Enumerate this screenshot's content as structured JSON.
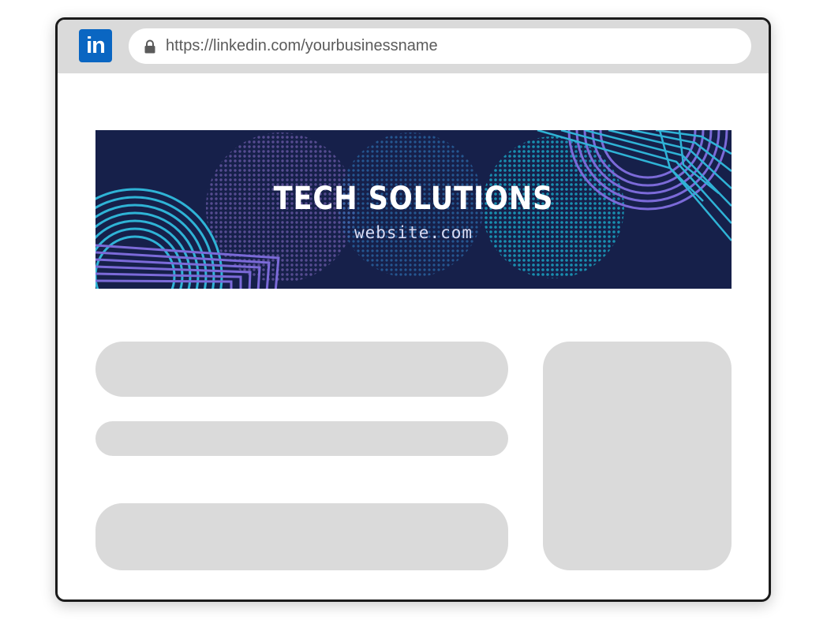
{
  "browser": {
    "logo_text": "in",
    "url": "https://linkedin.com/yourbusinessname",
    "icons": [
      "linkedin-logo",
      "lock-icon"
    ]
  },
  "banner": {
    "title": "TECH SOLUTIONS",
    "subtitle": "website.com",
    "colors": {
      "background": "#16204a",
      "accent_cyan": "#2fb3d6",
      "accent_purple": "#7b6ad8",
      "dot_cyan": "#1aa3c2",
      "dot_purple": "#6b5ba8"
    }
  },
  "placeholders": {
    "color": "#dadada"
  }
}
